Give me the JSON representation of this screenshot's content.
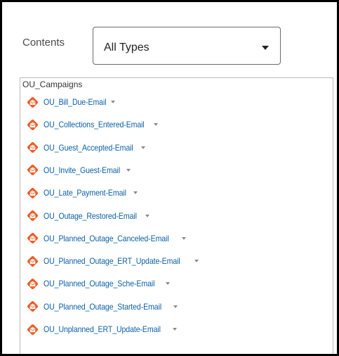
{
  "filter": {
    "label": "Contents",
    "selected_type": "All Types"
  },
  "tree": {
    "root_label": "OU_Campaigns",
    "items": [
      {
        "label": "OU_Bill_Due-Email"
      },
      {
        "label": "OU_Collections_Entered-Email"
      },
      {
        "label": "OU_Guest_Accepted-Email"
      },
      {
        "label": "OU_Invite_Guest-Email"
      },
      {
        "label": "OU_Late_Payment-Email"
      },
      {
        "label": "OU_Outage_Restored-Email"
      },
      {
        "label": "OU_Planned_Outage_Canceled-Email"
      },
      {
        "label": "OU_Planned_Outage_ERT_Update-Email"
      },
      {
        "label": "OU_Planned_Outage_Sche-Email"
      },
      {
        "label": "OU_Planned_Outage_Started-Email"
      },
      {
        "label": "OU_Unplanned_ERT_Update-Email"
      }
    ]
  },
  "colors": {
    "icon_orange": "#f05a22",
    "link_blue": "#0b5fa5",
    "frame_border": "#000000"
  },
  "icons": {
    "item_icon": "email-campaign-icon",
    "item_menu": "chevron-down-icon",
    "select_menu": "caret-down-icon"
  }
}
